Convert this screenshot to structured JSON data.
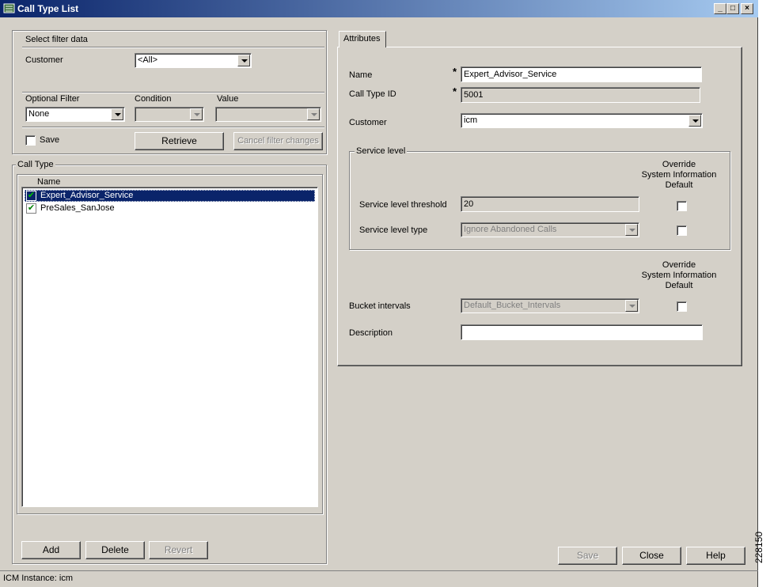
{
  "window": {
    "title": "Call Type List",
    "controls": [
      "_",
      "□",
      "×"
    ]
  },
  "filter": {
    "section_title": "Select filter data",
    "customer_label": "Customer",
    "customer_value": "<All>",
    "optional_filter_label": "Optional Filter",
    "optional_filter_value": "None",
    "condition_label": "Condition",
    "condition_value": "",
    "value_label": "Value",
    "value_value": "",
    "save_label": "Save",
    "save_checked": false,
    "retrieve_label": "Retrieve",
    "cancel_label": "Cancel filter changes"
  },
  "calltype": {
    "section_title": "Call Type",
    "column_header": "Name",
    "items": [
      {
        "name": "Expert_Advisor_Service",
        "selected": true
      },
      {
        "name": "PreSales_SanJose",
        "selected": false
      }
    ],
    "add_label": "Add",
    "delete_label": "Delete",
    "revert_label": "Revert"
  },
  "attributes": {
    "tab_label": "Attributes",
    "required_marker": "*",
    "name_label": "Name",
    "name_value": "Expert_Advisor_Service",
    "calltype_id_label": "Call Type ID",
    "calltype_id_value": "5001",
    "customer_label": "Customer",
    "customer_value": "icm",
    "service_level_title": "Service level",
    "override_line1": "Override",
    "override_line2": "System Information",
    "override_line3": "Default",
    "threshold_label": "Service level threshold",
    "threshold_value": "20",
    "sl_type_label": "Service level type",
    "sl_type_value": "Ignore Abandoned Calls",
    "bucket_label": "Bucket intervals",
    "bucket_value": "Default_Bucket_Intervals",
    "description_label": "Description",
    "description_value": ""
  },
  "footer": {
    "save_label": "Save",
    "close_label": "Close",
    "help_label": "Help"
  },
  "statusbar": {
    "text": "ICM Instance: icm"
  },
  "side_number": "228150"
}
